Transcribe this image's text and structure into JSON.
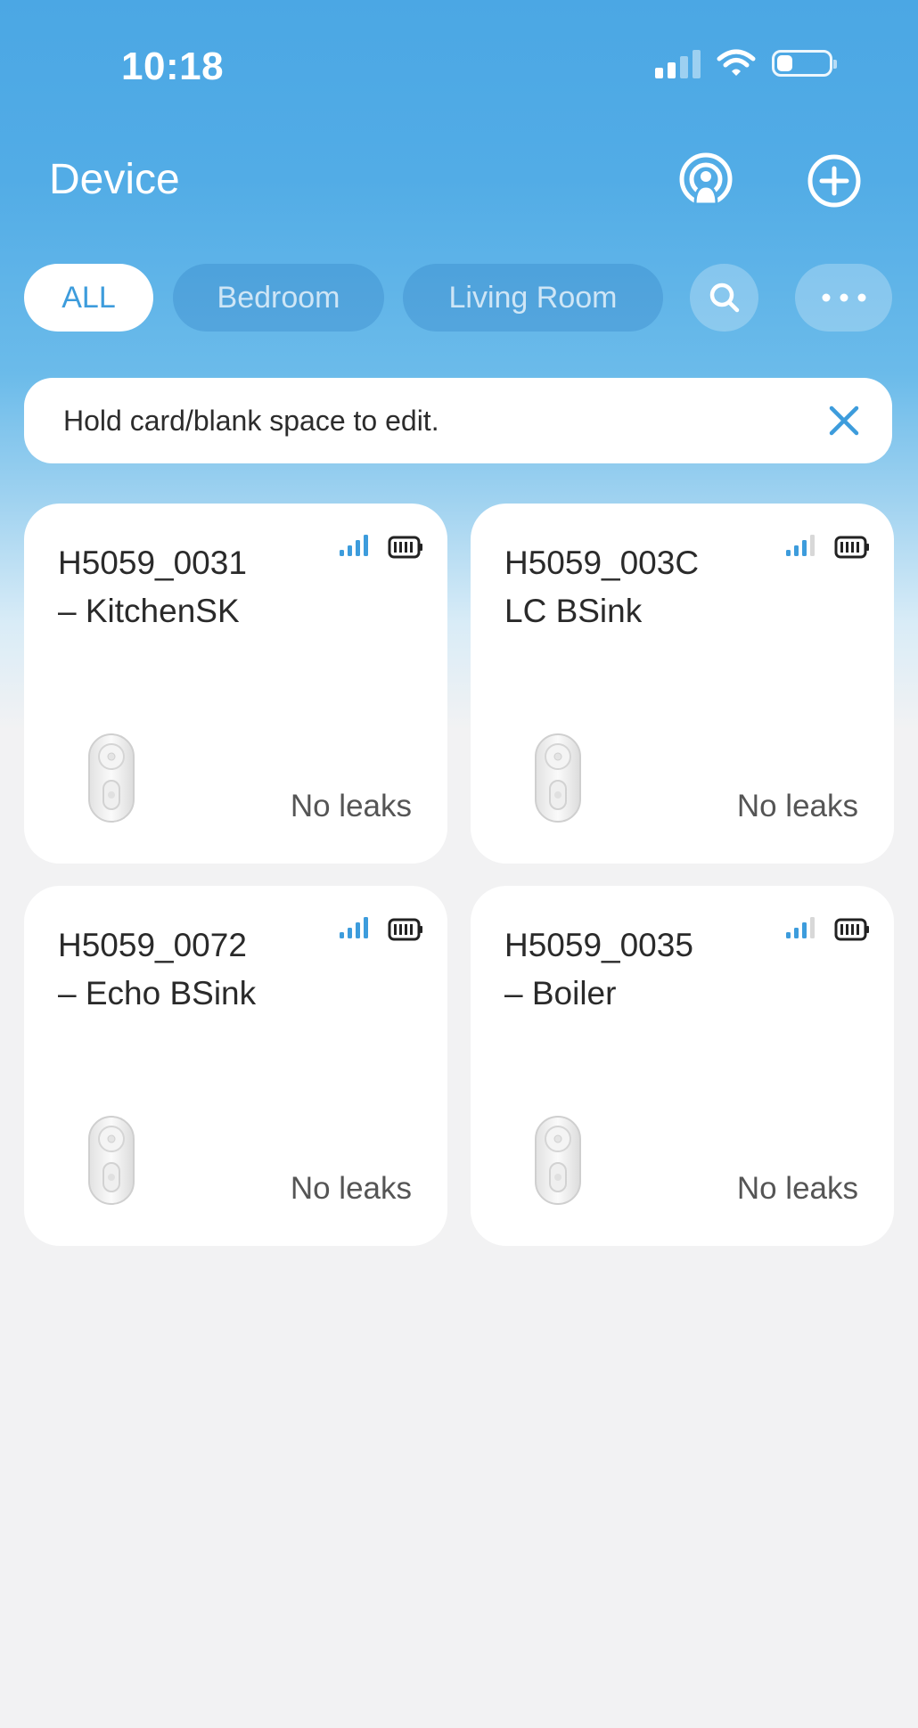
{
  "status_bar": {
    "time": "10:18",
    "battery_level": 0.3
  },
  "header": {
    "title": "Device",
    "scan_icon": "broadcast-scan-icon",
    "add_icon": "plus-circle-icon"
  },
  "filters": {
    "tabs": [
      "ALL",
      "Bedroom",
      "Living Room"
    ],
    "selected": "ALL",
    "search_icon": "search-icon",
    "more_icon": "more-horizontal-icon"
  },
  "hint": {
    "text": "Hold card/blank space to edit.",
    "close_icon": "close-icon"
  },
  "devices": [
    {
      "name": "H5059_0031\n– KitchenSK",
      "status": "No leaks",
      "signal_bars": 4
    },
    {
      "name": "H5059_003C\nLC BSink",
      "status": "No leaks",
      "signal_bars": 3
    },
    {
      "name": "H5059_0072\n– Echo BSink",
      "status": "No leaks",
      "signal_bars": 4
    },
    {
      "name": "H5059_0035\n– Boiler",
      "status": "No leaks",
      "signal_bars": 3
    }
  ],
  "colors": {
    "accent": "#3d9cdc",
    "header_gradient_top": "#4ba7e4",
    "background": "#f2f2f3"
  }
}
